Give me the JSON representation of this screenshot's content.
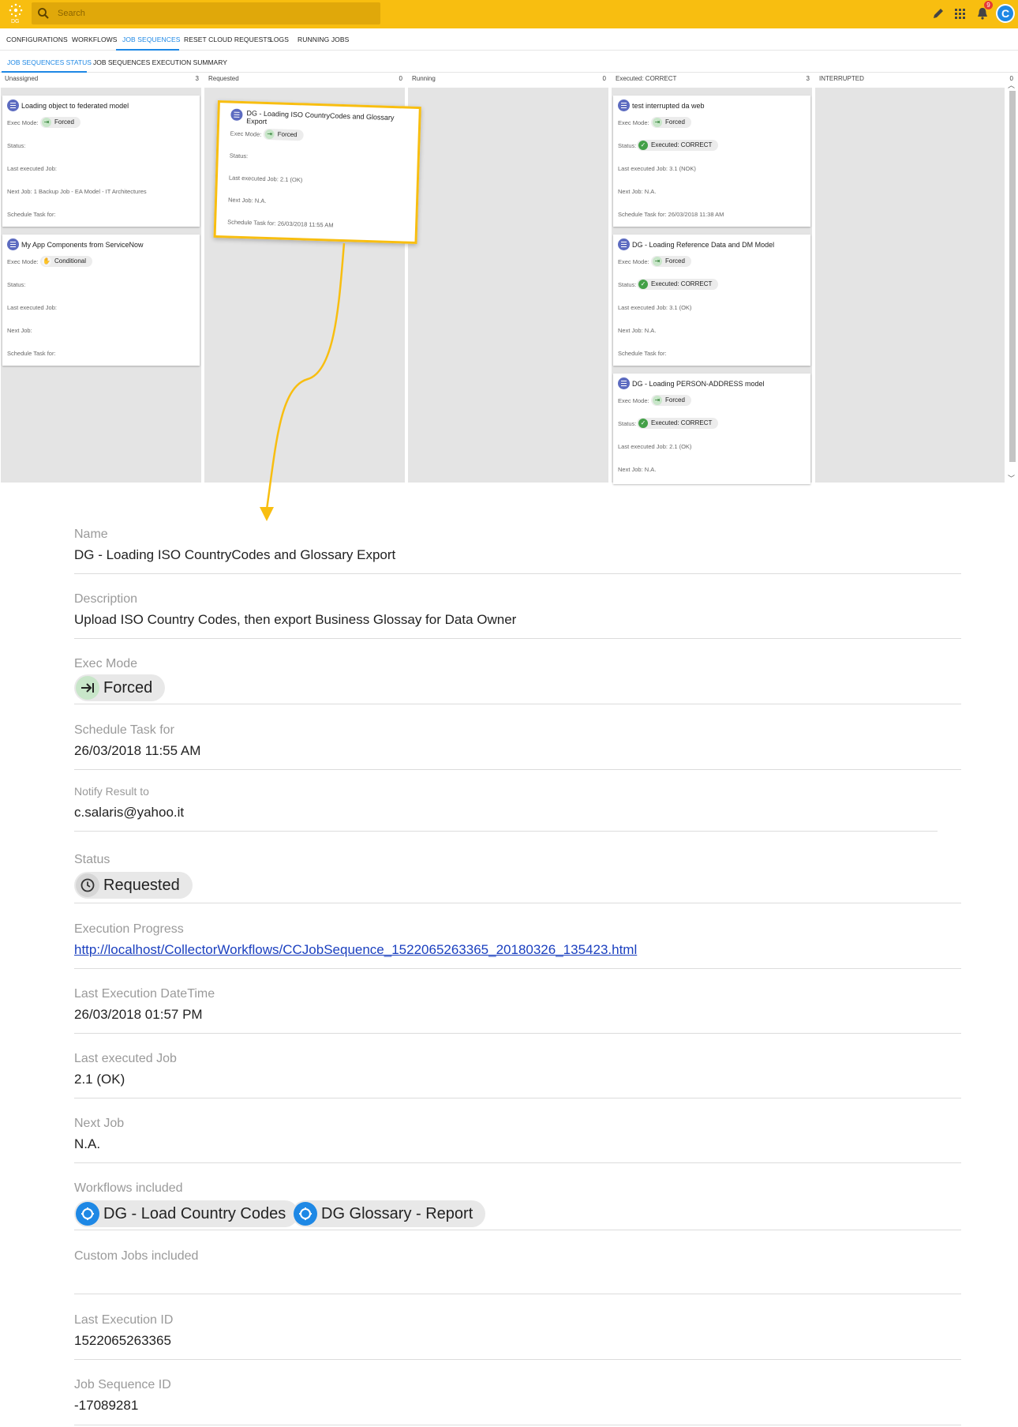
{
  "topbar": {
    "logo_text": "DG",
    "search_placeholder": "Search",
    "notifications_count": "9",
    "avatar_initial": "C"
  },
  "nav": {
    "tabs": [
      "CONFIGURATIONS",
      "WORKFLOWS",
      "JOB SEQUENCES",
      "RESET CLOUD REQUESTS",
      "LOGS",
      "RUNNING JOBS"
    ],
    "active": "JOB SEQUENCES"
  },
  "subnav": {
    "tabs": [
      "JOB SEQUENCES STATUS",
      "JOB SEQUENCES EXECUTION SUMMARY"
    ],
    "active": "JOB SEQUENCES STATUS"
  },
  "board": {
    "columns": [
      {
        "name": "Unassigned",
        "count": "3"
      },
      {
        "name": "Requested",
        "count": "0"
      },
      {
        "name": "Running",
        "count": "0"
      },
      {
        "name": "Executed: CORRECT",
        "count": "3"
      },
      {
        "name": "INTERRUPTED",
        "count": "0"
      }
    ],
    "labels": {
      "exec_mode": "Exec Mode:",
      "status": "Status:",
      "last_job": "Last executed Job:",
      "next_job": "Next Job:",
      "schedule": "Schedule Task for:"
    },
    "cards": {
      "u1": {
        "title": "Loading object to federated model",
        "mode": "Forced",
        "next_job": "1 Backup Job - EA Model - IT Architectures"
      },
      "u2": {
        "title": "My App Components from ServiceNow",
        "mode": "Conditional"
      },
      "r1": {
        "title": "DG - Loading ISO CountryCodes and Glossary Export",
        "mode": "Forced",
        "last_job": "2.1 (OK)",
        "next_job": "N.A.",
        "schedule": "26/03/2018 11:55 AM"
      },
      "e1": {
        "title": "test interrupted da web",
        "mode": "Forced",
        "status": "Executed: CORRECT",
        "last_job": "3.1 (NOK)",
        "next_job": "N.A.",
        "schedule": "26/03/2018 11:38 AM"
      },
      "e2": {
        "title": "DG - Loading Reference Data and DM Model",
        "mode": "Forced",
        "status": "Executed: CORRECT",
        "last_job": "3.1 (OK)",
        "next_job": "N.A."
      },
      "e3": {
        "title": "DG - Loading PERSON-ADDRESS model",
        "mode": "Forced",
        "status": "Executed: CORRECT",
        "last_job": "2.1 (OK)",
        "next_job": "N.A."
      }
    }
  },
  "detail": {
    "name_label": "Name",
    "name": "DG - Loading ISO CountryCodes and Glossary Export",
    "description_label": "Description",
    "description": "Upload ISO Country Codes, then export Business Glossay for Data Owner",
    "exec_mode_label": "Exec Mode",
    "exec_mode": "Forced",
    "schedule_label": "Schedule Task for",
    "schedule": "26/03/2018 11:55 AM",
    "notify_label": "Notify Result to",
    "notify": "c.salaris@yahoo.it",
    "status_label": "Status",
    "status": "Requested",
    "progress_label": "Execution Progress",
    "progress_link": "http://localhost/CollectorWorkflows/CCJobSequence_1522065263365_20180326_135423.html",
    "last_exec_dt_label": "Last Execution DateTime",
    "last_exec_dt": "26/03/2018 01:57 PM",
    "last_job_label": "Last executed Job",
    "last_job": "2.1 (OK)",
    "next_job_label": "Next Job",
    "next_job": "N.A.",
    "workflows_label": "Workflows included",
    "workflows": [
      "DG - Load Country Codes",
      "DG Glossary - Report"
    ],
    "custom_jobs_label": "Custom Jobs included",
    "last_exec_id_label": "Last Execution ID",
    "last_exec_id": "1522065263365",
    "job_seq_id_label": "Job Sequence ID",
    "job_seq_id": "-17089281"
  },
  "colors": {
    "accent": "#f8be10",
    "primary": "#1e88e5",
    "card_icon": "#5c6bc0",
    "success": "#43a047"
  },
  "icons": [
    "logo-icon",
    "search-icon",
    "pencil-icon",
    "apps-grid-icon",
    "bell-icon",
    "list-icon",
    "forced-arrow-icon",
    "hand-icon",
    "check-icon",
    "clock-icon",
    "workflow-icon",
    "scroll-up-icon",
    "scroll-down-icon"
  ]
}
